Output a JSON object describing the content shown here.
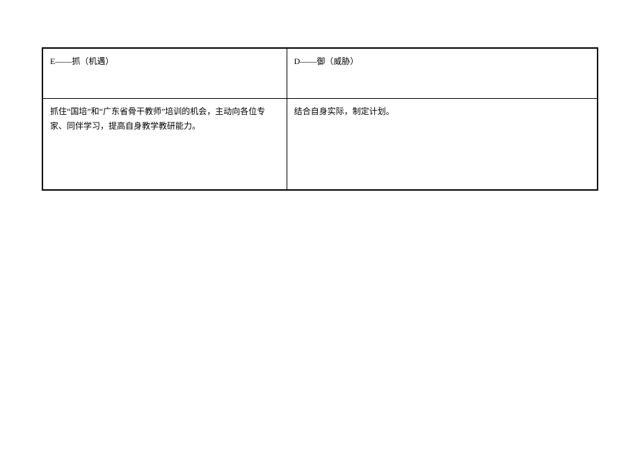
{
  "table": {
    "headers": {
      "left": "E——抓（机遇）",
      "right": "D——御（威胁）"
    },
    "cells": {
      "left": "抓住“国培”和“广东省骨干教师”培训的机会，主动向各位专家、同伴学习，提高自身教学教研能力。",
      "right": "结合自身实际，制定计划。"
    }
  }
}
